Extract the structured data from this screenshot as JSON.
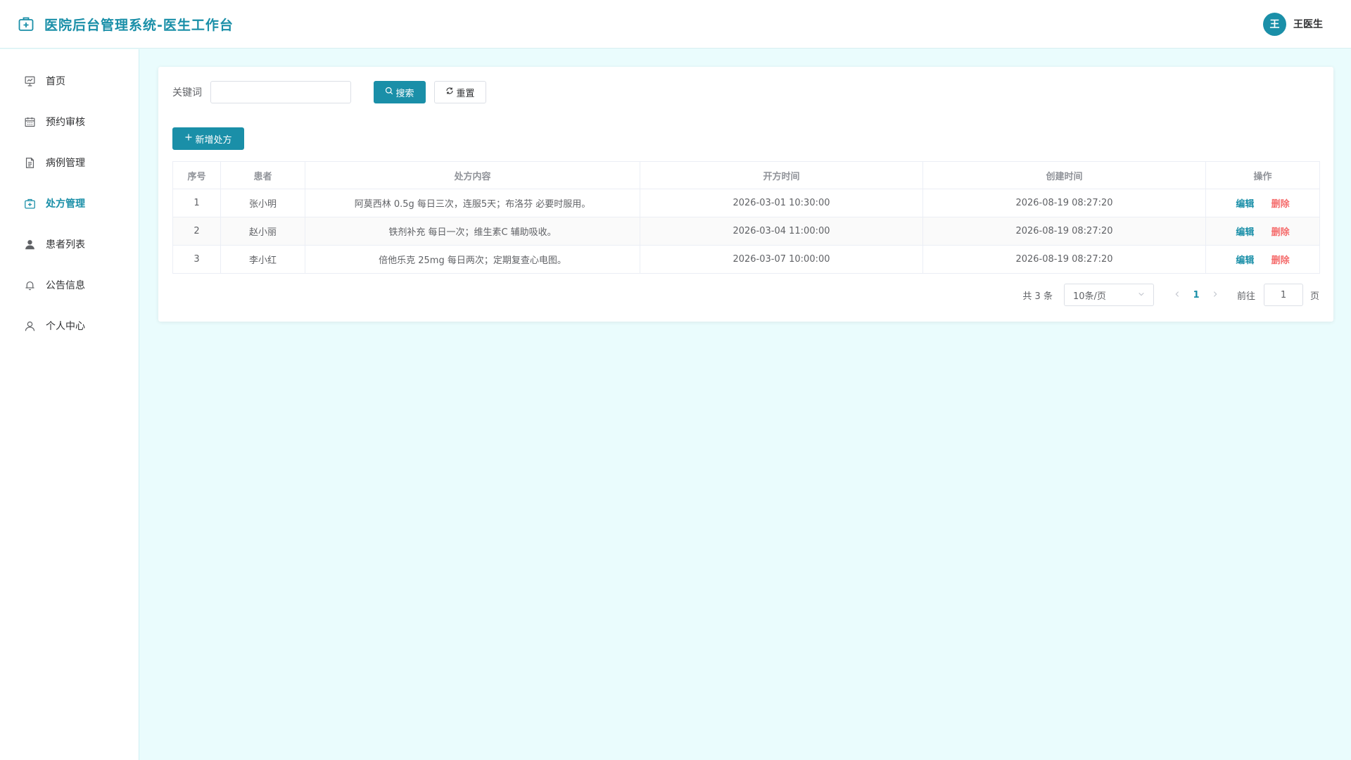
{
  "header": {
    "title": "医院后台管理系统-医生工作台",
    "user_avatar": "王",
    "user_name": "王医生",
    "icon": "medical-kit-icon"
  },
  "colors": {
    "accent": "#1a8fa8",
    "danger": "#f56c6c",
    "background": "#eafcfd"
  },
  "sidebar": {
    "items": [
      {
        "label": "首页",
        "icon": "dashboard-icon",
        "active": false
      },
      {
        "label": "预约审核",
        "icon": "calendar-icon",
        "active": false
      },
      {
        "label": "病例管理",
        "icon": "document-icon",
        "active": false
      },
      {
        "label": "处方管理",
        "icon": "medical-kit-icon",
        "active": true
      },
      {
        "label": "患者列表",
        "icon": "user-filled-icon",
        "active": false
      },
      {
        "label": "公告信息",
        "icon": "bell-icon",
        "active": false
      },
      {
        "label": "个人中心",
        "icon": "user-icon",
        "active": false
      }
    ]
  },
  "search": {
    "label": "关键词",
    "value": "",
    "placeholder": "",
    "search_button": "搜索",
    "reset_button": "重置"
  },
  "toolbar": {
    "add_button": "新增处方"
  },
  "table": {
    "columns": [
      "序号",
      "患者",
      "处方内容",
      "开方时间",
      "创建时间",
      "操作"
    ],
    "rows": [
      {
        "index": "1",
        "patient": "张小明",
        "content": "阿莫西林 0.5g 每日三次，连服5天；布洛芬 必要时服用。",
        "prescribed_at": "2026-03-01 10:30:00",
        "created_at": "2026-08-19 08:27:20"
      },
      {
        "index": "2",
        "patient": "赵小丽",
        "content": "铁剂补充 每日一次；维生素C 辅助吸收。",
        "prescribed_at": "2026-03-04 11:00:00",
        "created_at": "2026-08-19 08:27:20"
      },
      {
        "index": "3",
        "patient": "李小红",
        "content": "倍他乐克 25mg 每日两次；定期复查心电图。",
        "prescribed_at": "2026-03-07 10:00:00",
        "created_at": "2026-08-19 08:27:20"
      }
    ],
    "edit_label": "编辑",
    "delete_label": "删除"
  },
  "pagination": {
    "total_text": "共 3 条",
    "page_size": "10条/页",
    "current_page": "1",
    "goto_label": "前往",
    "goto_value": "1",
    "goto_unit": "页"
  }
}
